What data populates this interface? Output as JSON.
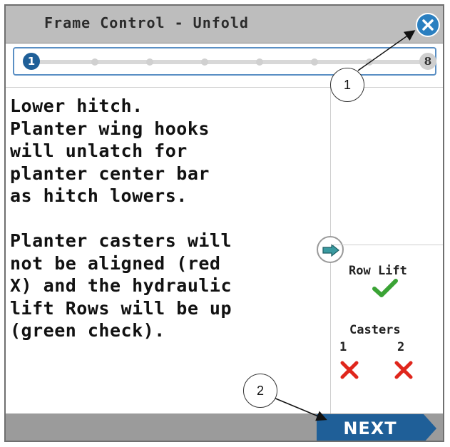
{
  "window": {
    "title": "Frame Control - Unfold"
  },
  "progress": {
    "current_step": "1",
    "total_steps": "8",
    "fraction": 0.0
  },
  "instructions": {
    "text": "Lower hitch.\nPlanter wing hooks\nwill unlatch for\nplanter center bar\nas hitch lowers.\n\nPlanter casters will\nnot be aligned (red\nX) and the hydraulic\nlift Rows will be up\n(green check)."
  },
  "status": {
    "row_lift_label": "Row Lift",
    "row_lift_state": "check",
    "casters_label": "Casters",
    "caster_1_label": "1",
    "caster_2_label": "2",
    "caster_1_state": "x",
    "caster_2_state": "x"
  },
  "actions": {
    "next_label": "NEXT"
  },
  "callouts": {
    "callout_1": "1",
    "callout_2": "2"
  },
  "colors": {
    "accent_blue": "#1f5f98",
    "check_green": "#3aa335",
    "x_red": "#e0261c",
    "titlebar_gray": "#bdbdbd"
  },
  "icons": {
    "close": "close-icon",
    "arrow": "arrow-right-icon",
    "check": "check-icon",
    "x": "x-mark-icon"
  }
}
